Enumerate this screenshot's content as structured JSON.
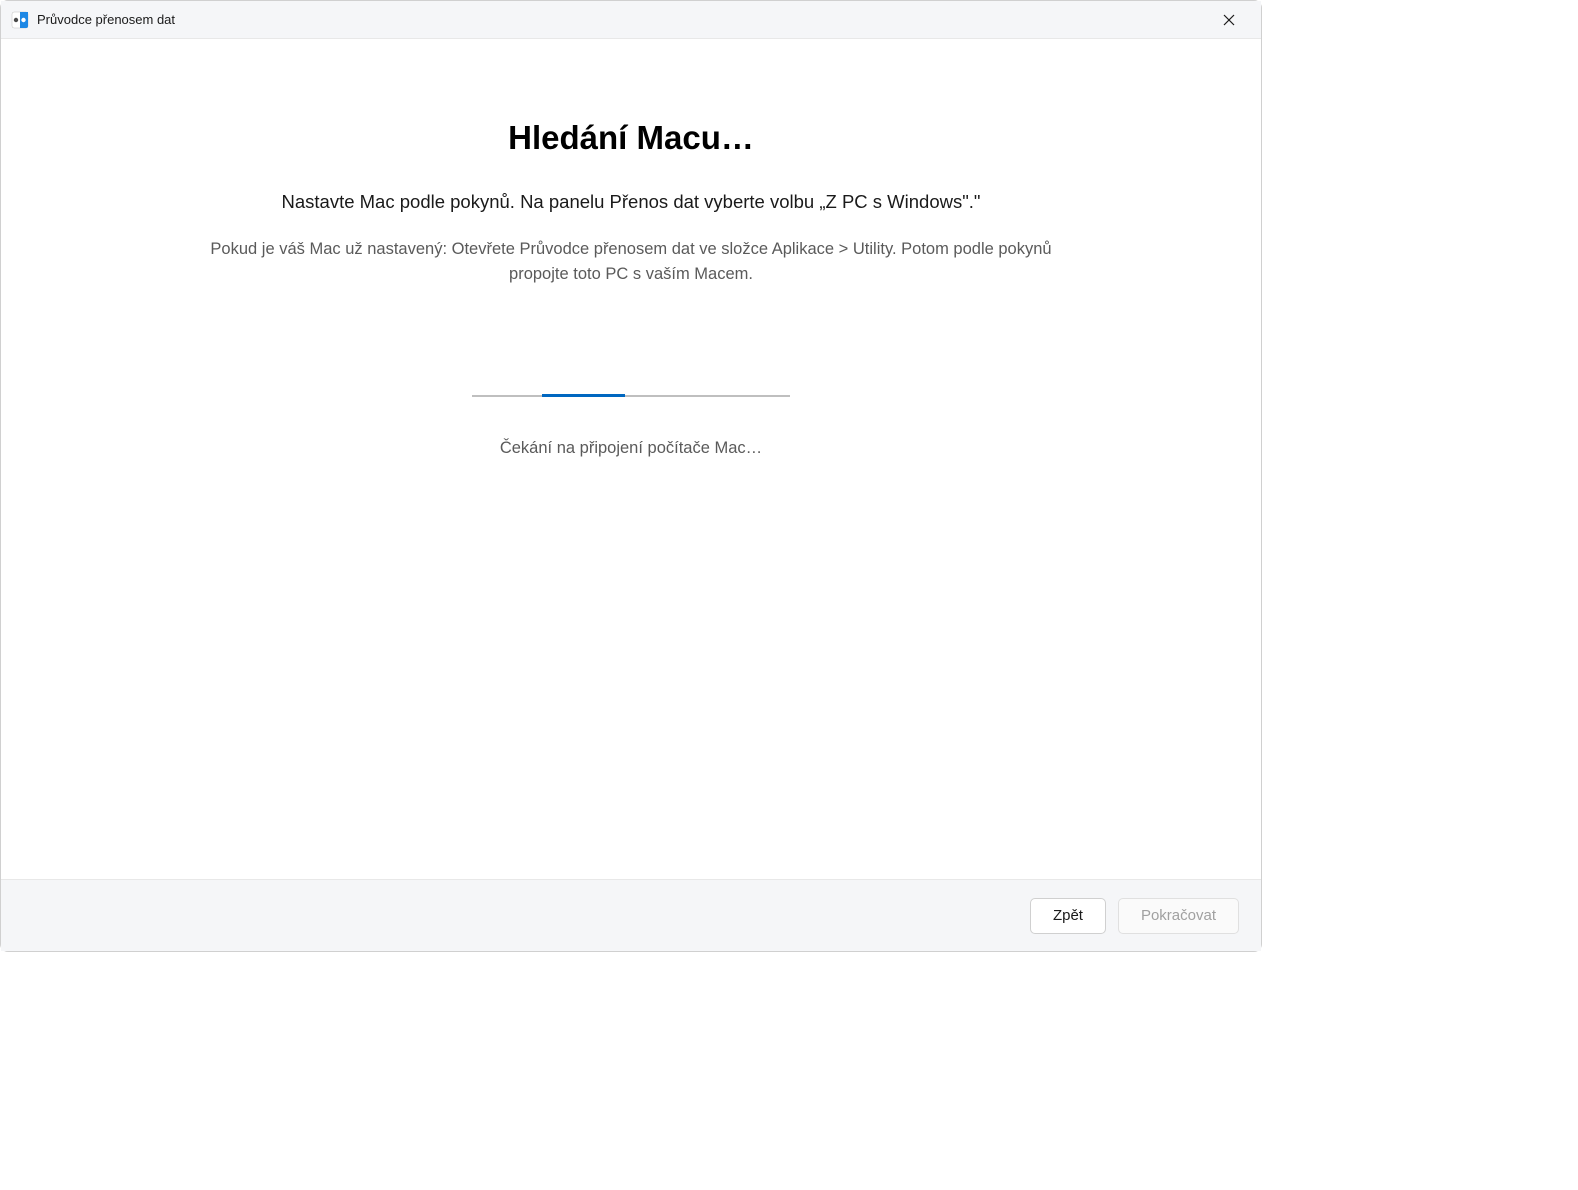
{
  "window": {
    "title": "Průvodce přenosem dat"
  },
  "main": {
    "heading": "Hledání Macu…",
    "instruction": "Nastavte Mac podle pokynů. Na panelu Přenos dat vyberte volbu „Z PC s Windows\".\"",
    "subtext": "Pokud je váš Mac už nastavený: Otevřete Průvodce přenosem dat ve složce Aplikace > Utility. Potom podle pokynů propojte toto PC s vaším Macem.",
    "waiting": "Čekání na připojení počítače Mac…"
  },
  "footer": {
    "back_label": "Zpět",
    "continue_label": "Pokračovat"
  }
}
